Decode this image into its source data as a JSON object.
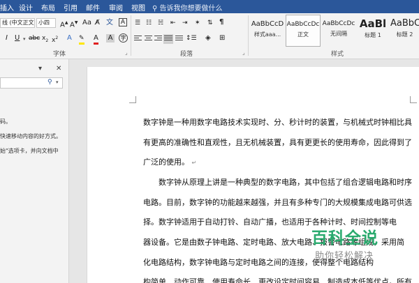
{
  "tabs": {
    "insert": "插入",
    "design": "设计",
    "layout": "布局",
    "references": "引用",
    "mailings": "邮件",
    "review": "审阅",
    "view": "视图",
    "tell_me": "告诉我你想要做什么"
  },
  "font_group": {
    "font_name": "线 (中文正文)",
    "font_size": "小四",
    "label": "字体"
  },
  "paragraph_group": {
    "label": "段落"
  },
  "styles_group": {
    "label": "样式",
    "styles": [
      {
        "sample": "AaBbCcD",
        "name": "样式aaa..."
      },
      {
        "sample": "AaBbCcDc",
        "name": "正文"
      },
      {
        "sample": "AaBbCcDc",
        "name": "无间隔"
      },
      {
        "sample": "AaBl",
        "name": "标题 1"
      },
      {
        "sample": "AaBbC",
        "name": "标题 2"
      }
    ]
  },
  "nav_pane": {
    "text1": "码。",
    "text2": "快速移动内容的好方式。",
    "text3": "始\"选项卡，并向文档中"
  },
  "document": {
    "lines": [
      "数字钟是一种用数字电路技术实现时、分、秒计时的装置，与机械式时钟相比具",
      "有更高的准确性和直观性，且无机械装置，具有更更长的使用寿命，因此得到了",
      "广泛的使用。",
      "数字钟从原理上讲是一种典型的数字电路，其中包括了组合逻辑电路和时序",
      "电路。目前，数字钟的功能越来越强，并且有多种专门的大规模集成电路可供选",
      "择。数字钟适用于自动打铃、自动广播，也适用于各种计时、时间控制等电",
      "器设备。它是由数子钟电路、定时电路、放大电路、报警电路等组成，采用简",
      "化电路结构，数字钟电路与定时电路之间的连接，使得整个电路结构",
      "构简单、动作可靠、使用寿命长、更改设定时间容易、制造成本低等优点。所有"
    ],
    "paragraph_mark": "↵"
  },
  "watermark": {
    "title": "百科全说",
    "subtitle": "助你轻松解决"
  },
  "colors": {
    "tab_bar": "#2b579a",
    "ribbon": "#f3f3f3",
    "workspace": "#e6e6e6",
    "watermark_green": "#2aaa6e"
  }
}
